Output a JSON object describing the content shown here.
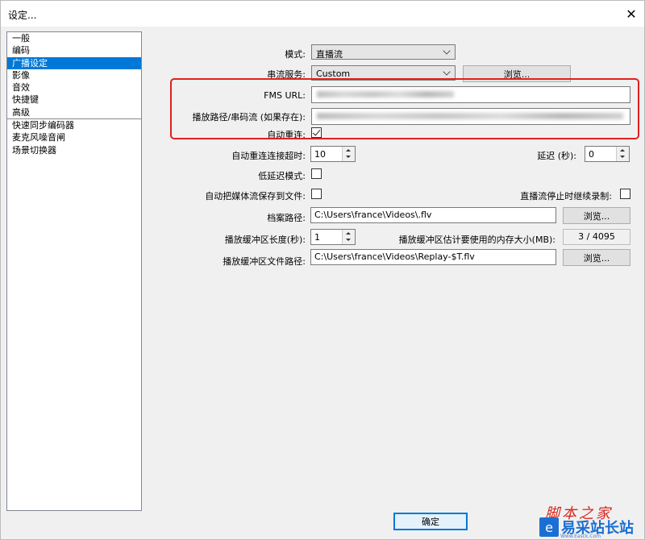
{
  "window": {
    "title": "设定...",
    "close_glyph": "✕"
  },
  "sidebar": {
    "items": [
      {
        "label": "一般"
      },
      {
        "label": "编码"
      },
      {
        "label": "广播设定",
        "selected": true
      },
      {
        "label": "影像"
      },
      {
        "label": "音效"
      },
      {
        "label": "快捷键"
      },
      {
        "label": "高级"
      },
      {
        "label": "快速同步编码器"
      },
      {
        "label": "麦克风噪音闸"
      },
      {
        "label": "场景切换器"
      }
    ]
  },
  "form": {
    "mode": {
      "label": "模式:",
      "value": "直播流"
    },
    "service": {
      "label": "串流服务:",
      "value": "Custom",
      "browse": "浏览..."
    },
    "fms_url": {
      "label": "FMS URL:"
    },
    "play_path": {
      "label": "播放路径/串码流 (如果存在):"
    },
    "auto_reconnect": {
      "label": "自动重连:",
      "checked": true
    },
    "reconnect_timeout": {
      "label": "自动重连连接超时:",
      "value": "10"
    },
    "delay": {
      "label": "延迟 (秒):",
      "value": "0"
    },
    "low_latency": {
      "label": "低延迟模式:",
      "checked": false
    },
    "auto_save": {
      "label": "自动把媒体流保存到文件:",
      "checked": false
    },
    "keep_recording": {
      "label": "直播流停止时继续录制:",
      "checked": false
    },
    "file_path": {
      "label": "档案路径:",
      "value": "C:\\Users\\france\\Videos\\.flv",
      "browse": "浏览..."
    },
    "buffer_length": {
      "label": "播放缓冲区长度(秒):",
      "value": "1"
    },
    "buffer_memory": {
      "label": "播放缓冲区估计要使用的内存大小(MB):",
      "value": "3 / 4095"
    },
    "buffer_path": {
      "label": "播放缓冲区文件路径:",
      "value": "C:\\Users\\france\\Videos\\Replay-$T.flv",
      "browse": "浏览..."
    }
  },
  "footer": {
    "ok": "确定"
  },
  "watermark": {
    "line1": "脚本之家",
    "logo_glyph": "e",
    "line2": "易采站长站",
    "line3": "Www.Easck.Com"
  },
  "colors": {
    "selection": "#0078d7",
    "highlight_box": "#e02020"
  }
}
